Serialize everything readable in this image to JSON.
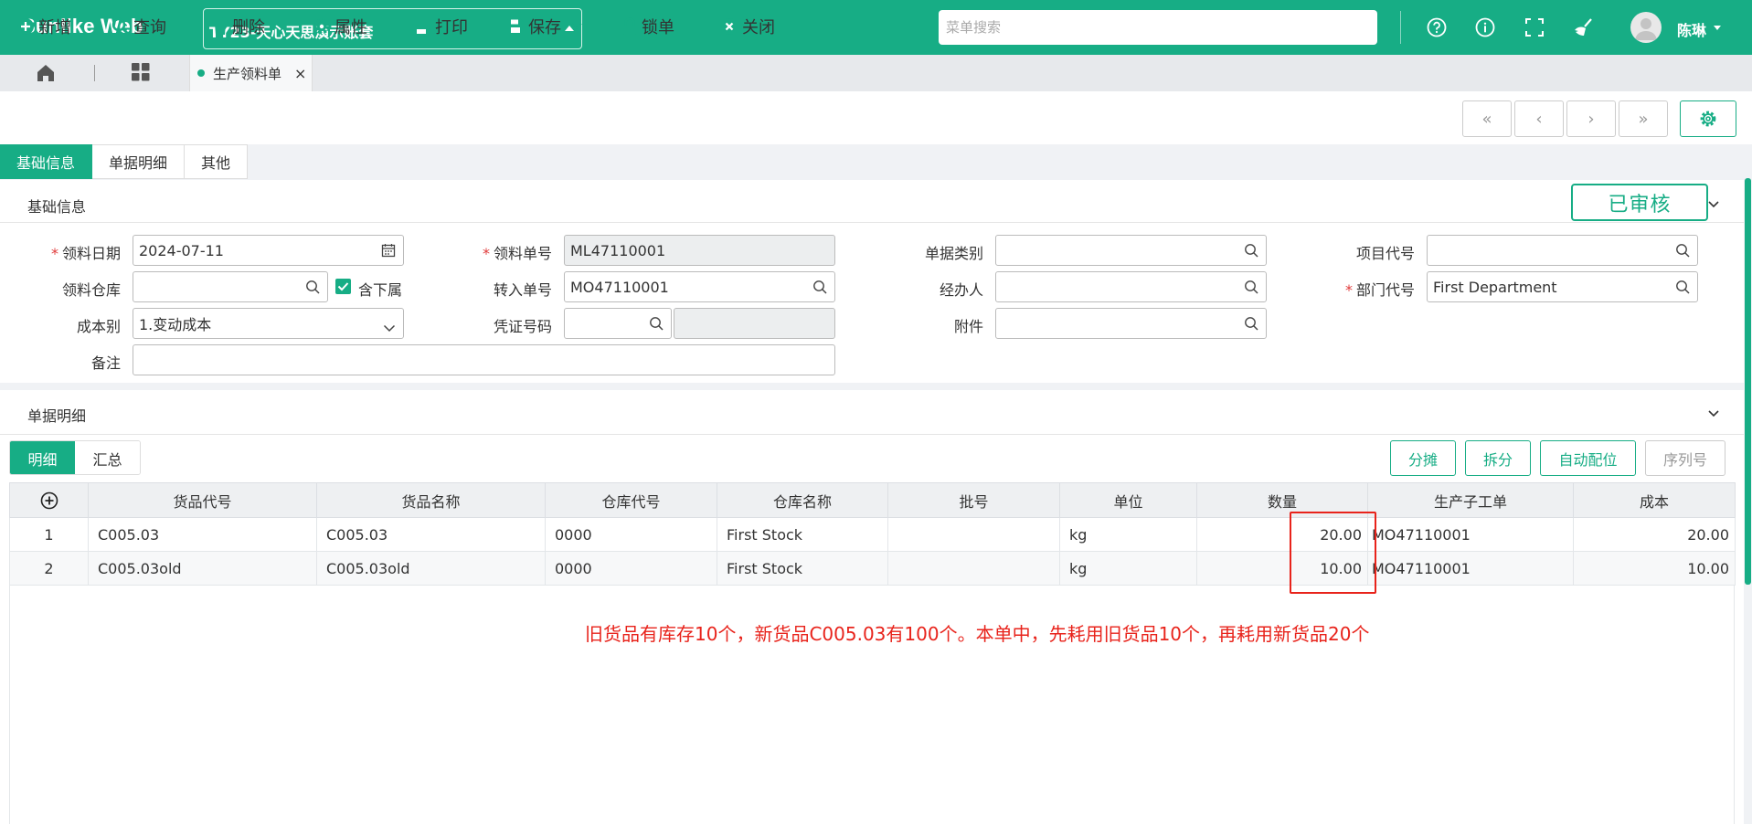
{
  "app": {
    "brand": "Sunlike Web",
    "account": "TY23-天心天思演示账套",
    "menu_search_placeholder": "菜单搜索",
    "user_name": "陈琳"
  },
  "tabs": {
    "doc_tab": "生产领料单",
    "close": "×"
  },
  "toolbar": {
    "add": "新增",
    "query": "查询",
    "delete": "删除",
    "properties": "属性",
    "print": "打印",
    "save": "保存",
    "lock": "锁单",
    "close": "关闭"
  },
  "nav": {
    "first": "«",
    "prev": "‹",
    "next": "›",
    "last": "»"
  },
  "section_tabs": [
    "基础信息",
    "单据明细",
    "其他"
  ],
  "basic": {
    "title": "基础信息",
    "status": "已审核",
    "fields": {
      "pick_date": {
        "label": "领料日期",
        "value": "2024-07-11",
        "required": true
      },
      "pick_no": {
        "label": "领料单号",
        "value": "ML47110001",
        "required": true
      },
      "doc_type": {
        "label": "单据类别",
        "value": ""
      },
      "project_code": {
        "label": "项目代号",
        "value": ""
      },
      "warehouse": {
        "label": "领料仓库",
        "value": ""
      },
      "include_sub": {
        "label": "含下属",
        "checked": true
      },
      "transfer_no": {
        "label": "转入单号",
        "value": "MO47110001"
      },
      "handler": {
        "label": "经办人",
        "value": ""
      },
      "dept_code": {
        "label": "部门代号",
        "value": "First Department",
        "required": true
      },
      "cost_type": {
        "label": "成本别",
        "value": "1.变动成本"
      },
      "voucher_no": {
        "label": "凭证号码",
        "value": ""
      },
      "attachment": {
        "label": "附件",
        "value": ""
      },
      "remark": {
        "label": "备注",
        "value": ""
      }
    }
  },
  "detail": {
    "title": "单据明细",
    "sub_tabs": [
      "明细",
      "汇总"
    ],
    "actions": [
      "分摊",
      "拆分",
      "自动配位",
      "序列号"
    ],
    "columns": [
      "",
      "货品代号",
      "货品名称",
      "仓库代号",
      "仓库名称",
      "批号",
      "单位",
      "数量",
      "生产子工单",
      "成本"
    ],
    "rows": [
      [
        "1",
        "C005.03",
        "C005.03",
        "0000",
        "First Stock",
        "",
        "kg",
        "20.00",
        "MO47110001",
        "20.00"
      ],
      [
        "2",
        "C005.03old",
        "C005.03old",
        "0000",
        "First Stock",
        "",
        "kg",
        "10.00",
        "MO47110001",
        "10.00"
      ]
    ],
    "annotation": "旧货品有库存10个，新货品C005.03有100个。本单中，先耗用旧货品10个，再耗用新货品20个"
  },
  "colors": {
    "brand": "#17ad85",
    "annotation": "#e8231b"
  }
}
